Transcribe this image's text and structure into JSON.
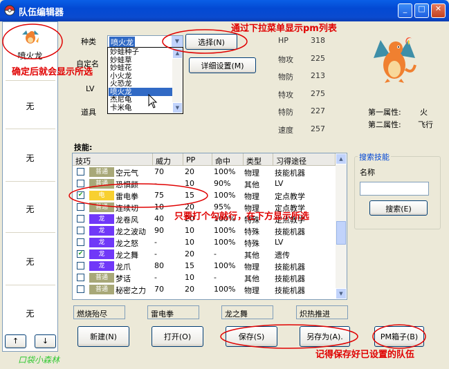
{
  "window": {
    "title": "队伍编辑器",
    "minimize": "_",
    "maximize": "□",
    "close": "✕"
  },
  "party": {
    "slots": [
      "喷火龙",
      "无",
      "无",
      "无",
      "无",
      "无"
    ],
    "up": "↑",
    "down": "↓",
    "watermark": "口袋小森林"
  },
  "form": {
    "species_label": "种类",
    "nickname_label": "自定名",
    "level_label": "LV",
    "item_label": "道具",
    "species_value": "喷火龙",
    "species_options": [
      "妙蛙种子",
      "妙蛙草",
      "妙蛙花",
      "小火龙",
      "火恐龙",
      "喷火龙",
      "杰尼龟",
      "卡米龟"
    ],
    "selected_index": 5,
    "select_button": "选择(N)",
    "detail_button": "详细设置(M)"
  },
  "stats": [
    {
      "label": "HP",
      "value": "318"
    },
    {
      "label": "物攻",
      "value": "225"
    },
    {
      "label": "物防",
      "value": "213"
    },
    {
      "label": "特攻",
      "value": "275"
    },
    {
      "label": "特防",
      "value": "227"
    },
    {
      "label": "速度",
      "value": "257"
    }
  ],
  "attributes": {
    "first_label": "第一属性:",
    "first_value": "火",
    "second_label": "第二属性:",
    "second_value": "飞行"
  },
  "skills": {
    "label": "技能:",
    "headers": [
      "技巧",
      "威力",
      "PP",
      "命中",
      "类型",
      "习得途径"
    ],
    "rows": [
      {
        "checked": false,
        "type": "普通",
        "color": "#A8A878",
        "name": "空元气",
        "power": "70",
        "pp": "20",
        "acc": "100%",
        "cat": "物理",
        "learn": "技能机器"
      },
      {
        "checked": false,
        "type": "普通",
        "color": "#A8A878",
        "name": "恐惧颜",
        "power": "-",
        "pp": "10",
        "acc": "90%",
        "cat": "其他",
        "learn": "LV"
      },
      {
        "checked": true,
        "type": "电",
        "color": "#F8D030",
        "name": "雷电拳",
        "power": "75",
        "pp": "15",
        "acc": "100%",
        "cat": "物理",
        "learn": "定点教学"
      },
      {
        "checked": false,
        "type": "普通",
        "color": "#A8A878",
        "name": "连续切",
        "power": "10",
        "pp": "20",
        "acc": "95%",
        "cat": "物理",
        "learn": "定点教学"
      },
      {
        "checked": false,
        "type": "龙",
        "color": "#7038F8",
        "name": "龙卷风",
        "power": "40",
        "pp": "20",
        "acc": "100%",
        "cat": "特殊",
        "learn": "定点教学"
      },
      {
        "checked": false,
        "type": "龙",
        "color": "#7038F8",
        "name": "龙之波动",
        "power": "90",
        "pp": "10",
        "acc": "100%",
        "cat": "特殊",
        "learn": "技能机器"
      },
      {
        "checked": false,
        "type": "龙",
        "color": "#7038F8",
        "name": "龙之怒",
        "power": "-",
        "pp": "10",
        "acc": "100%",
        "cat": "特殊",
        "learn": "LV"
      },
      {
        "checked": true,
        "type": "龙",
        "color": "#7038F8",
        "name": "龙之舞",
        "power": "-",
        "pp": "20",
        "acc": "-",
        "cat": "其他",
        "learn": "遗传"
      },
      {
        "checked": false,
        "type": "龙",
        "color": "#7038F8",
        "name": "龙爪",
        "power": "80",
        "pp": "15",
        "acc": "100%",
        "cat": "物理",
        "learn": "技能机器"
      },
      {
        "checked": false,
        "type": "普通",
        "color": "#A8A878",
        "name": "梦话",
        "power": "-",
        "pp": "10",
        "acc": "-",
        "cat": "其他",
        "learn": "技能机器"
      },
      {
        "checked": false,
        "type": "普通",
        "color": "#A8A878",
        "name": "秘密之力",
        "power": "70",
        "pp": "20",
        "acc": "100%",
        "cat": "物理",
        "learn": "技能机器"
      }
    ],
    "selected": [
      "燃烧殆尽",
      "雷电拳",
      "龙之舞",
      "炽热推进"
    ]
  },
  "search": {
    "group_label": "搜索技能",
    "name_label": "名称",
    "value": "",
    "button": "搜索(E)"
  },
  "buttons": {
    "new": "新建(N)",
    "open": "打开(O)",
    "save": "保存(S)",
    "save_as": "另存为(A).",
    "pm_box": "PM箱子(B)"
  },
  "annotations": {
    "dropdown_note": "通过下拉菜单显示pm列表",
    "confirm_note": "确定后就会显示所选",
    "skill_note": "只要打个勾就行，在下方显示所选",
    "save_note": "记得保存好已设置的队伍"
  },
  "colors": {
    "titlebar": "#0A4BD0",
    "annotation": "#E00000",
    "dragon": "#7038F8",
    "normal": "#A8A878",
    "electric": "#F8D030"
  }
}
